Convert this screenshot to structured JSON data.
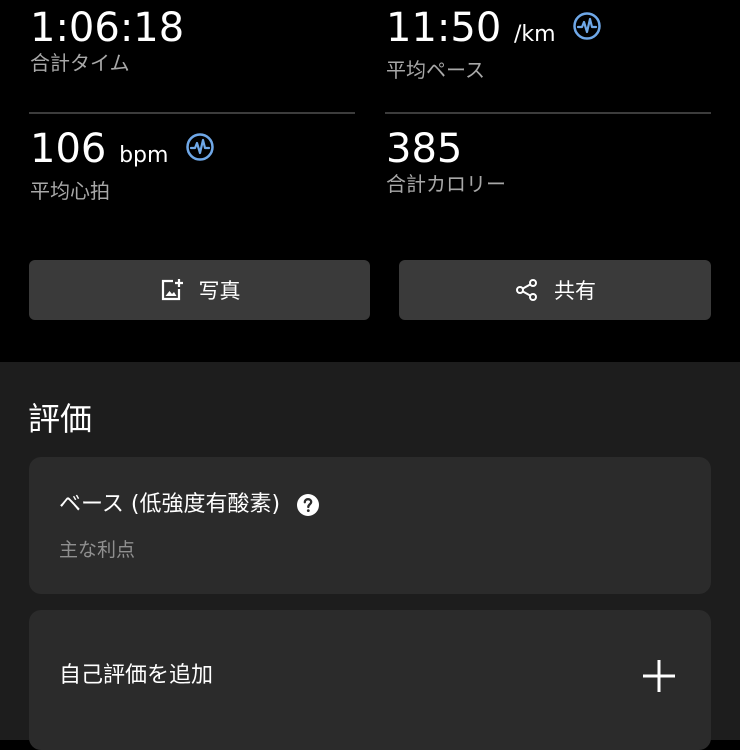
{
  "stats": {
    "total_time": {
      "value": "1:06:18",
      "label": "合計タイム"
    },
    "avg_pace": {
      "value": "11:50",
      "unit": "/km",
      "label": "平均ペース"
    },
    "avg_hr": {
      "value": "106",
      "unit": "bpm",
      "label": "平均心拍"
    },
    "calories": {
      "value": "385",
      "label": "合計カロリー"
    }
  },
  "buttons": {
    "photo": "写真",
    "share": "共有"
  },
  "evaluation": {
    "title": "評価",
    "training_effect": {
      "title": "ベース (低強度有酸素)",
      "subtitle": "主な利点"
    },
    "self_eval": "自己評価を追加"
  },
  "colors": {
    "accent": "#6fa8e8",
    "card": "#2b2b2b",
    "button": "#3a3a3a"
  }
}
